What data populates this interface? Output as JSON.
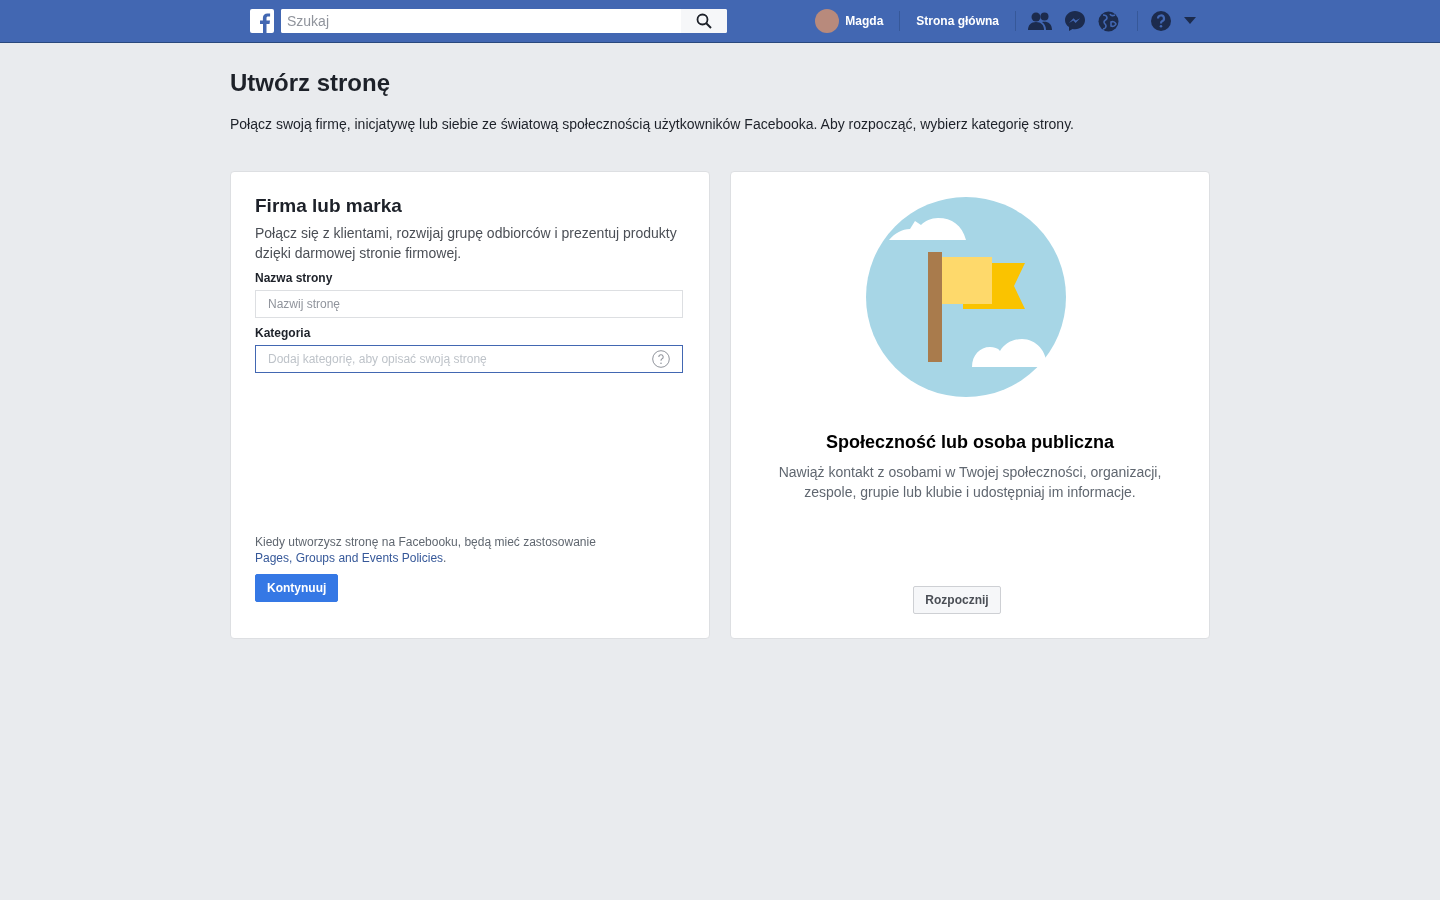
{
  "topbar": {
    "search": {
      "placeholder": "Szukaj"
    },
    "user": "Magda",
    "home": "Strona główna"
  },
  "header": {
    "title": "Utwórz stronę",
    "subtitle": "Połącz swoją firmę, inicjatywę lub siebie ze światową społecznością użytkowników Facebooka. Aby rozpocząć, wybierz kategorię strony."
  },
  "business_card": {
    "title": "Firma lub marka",
    "description": "Połącz się z klientami, rozwijaj grupę odbiorców i prezentuj produkty dzięki darmowej stronie firmowej.",
    "fields": [
      {
        "kind": "text",
        "label": "Nazwa strony",
        "placeholder": "Nazwij stronę",
        "focused": false
      },
      {
        "kind": "category",
        "label": "Kategoria",
        "placeholder": "Dodaj kategorię, aby opisać swoją stronę",
        "focused": true
      }
    ],
    "policy_text": "Kiedy utworzysz stronę na Facebooku, będą mieć zastosowanie ",
    "policy_link": "Pages, Groups and Events Policies",
    "policy_end": ".",
    "button": "Kontynuuj"
  },
  "community_card": {
    "title": "Społeczność lub osoba publiczna",
    "description": "Nawiąż kontakt z osobami w Twojej społeczności, organizacji, zespole, grupie lub klubie i udostępniaj im informacje.",
    "button": "Rozpocznij"
  }
}
